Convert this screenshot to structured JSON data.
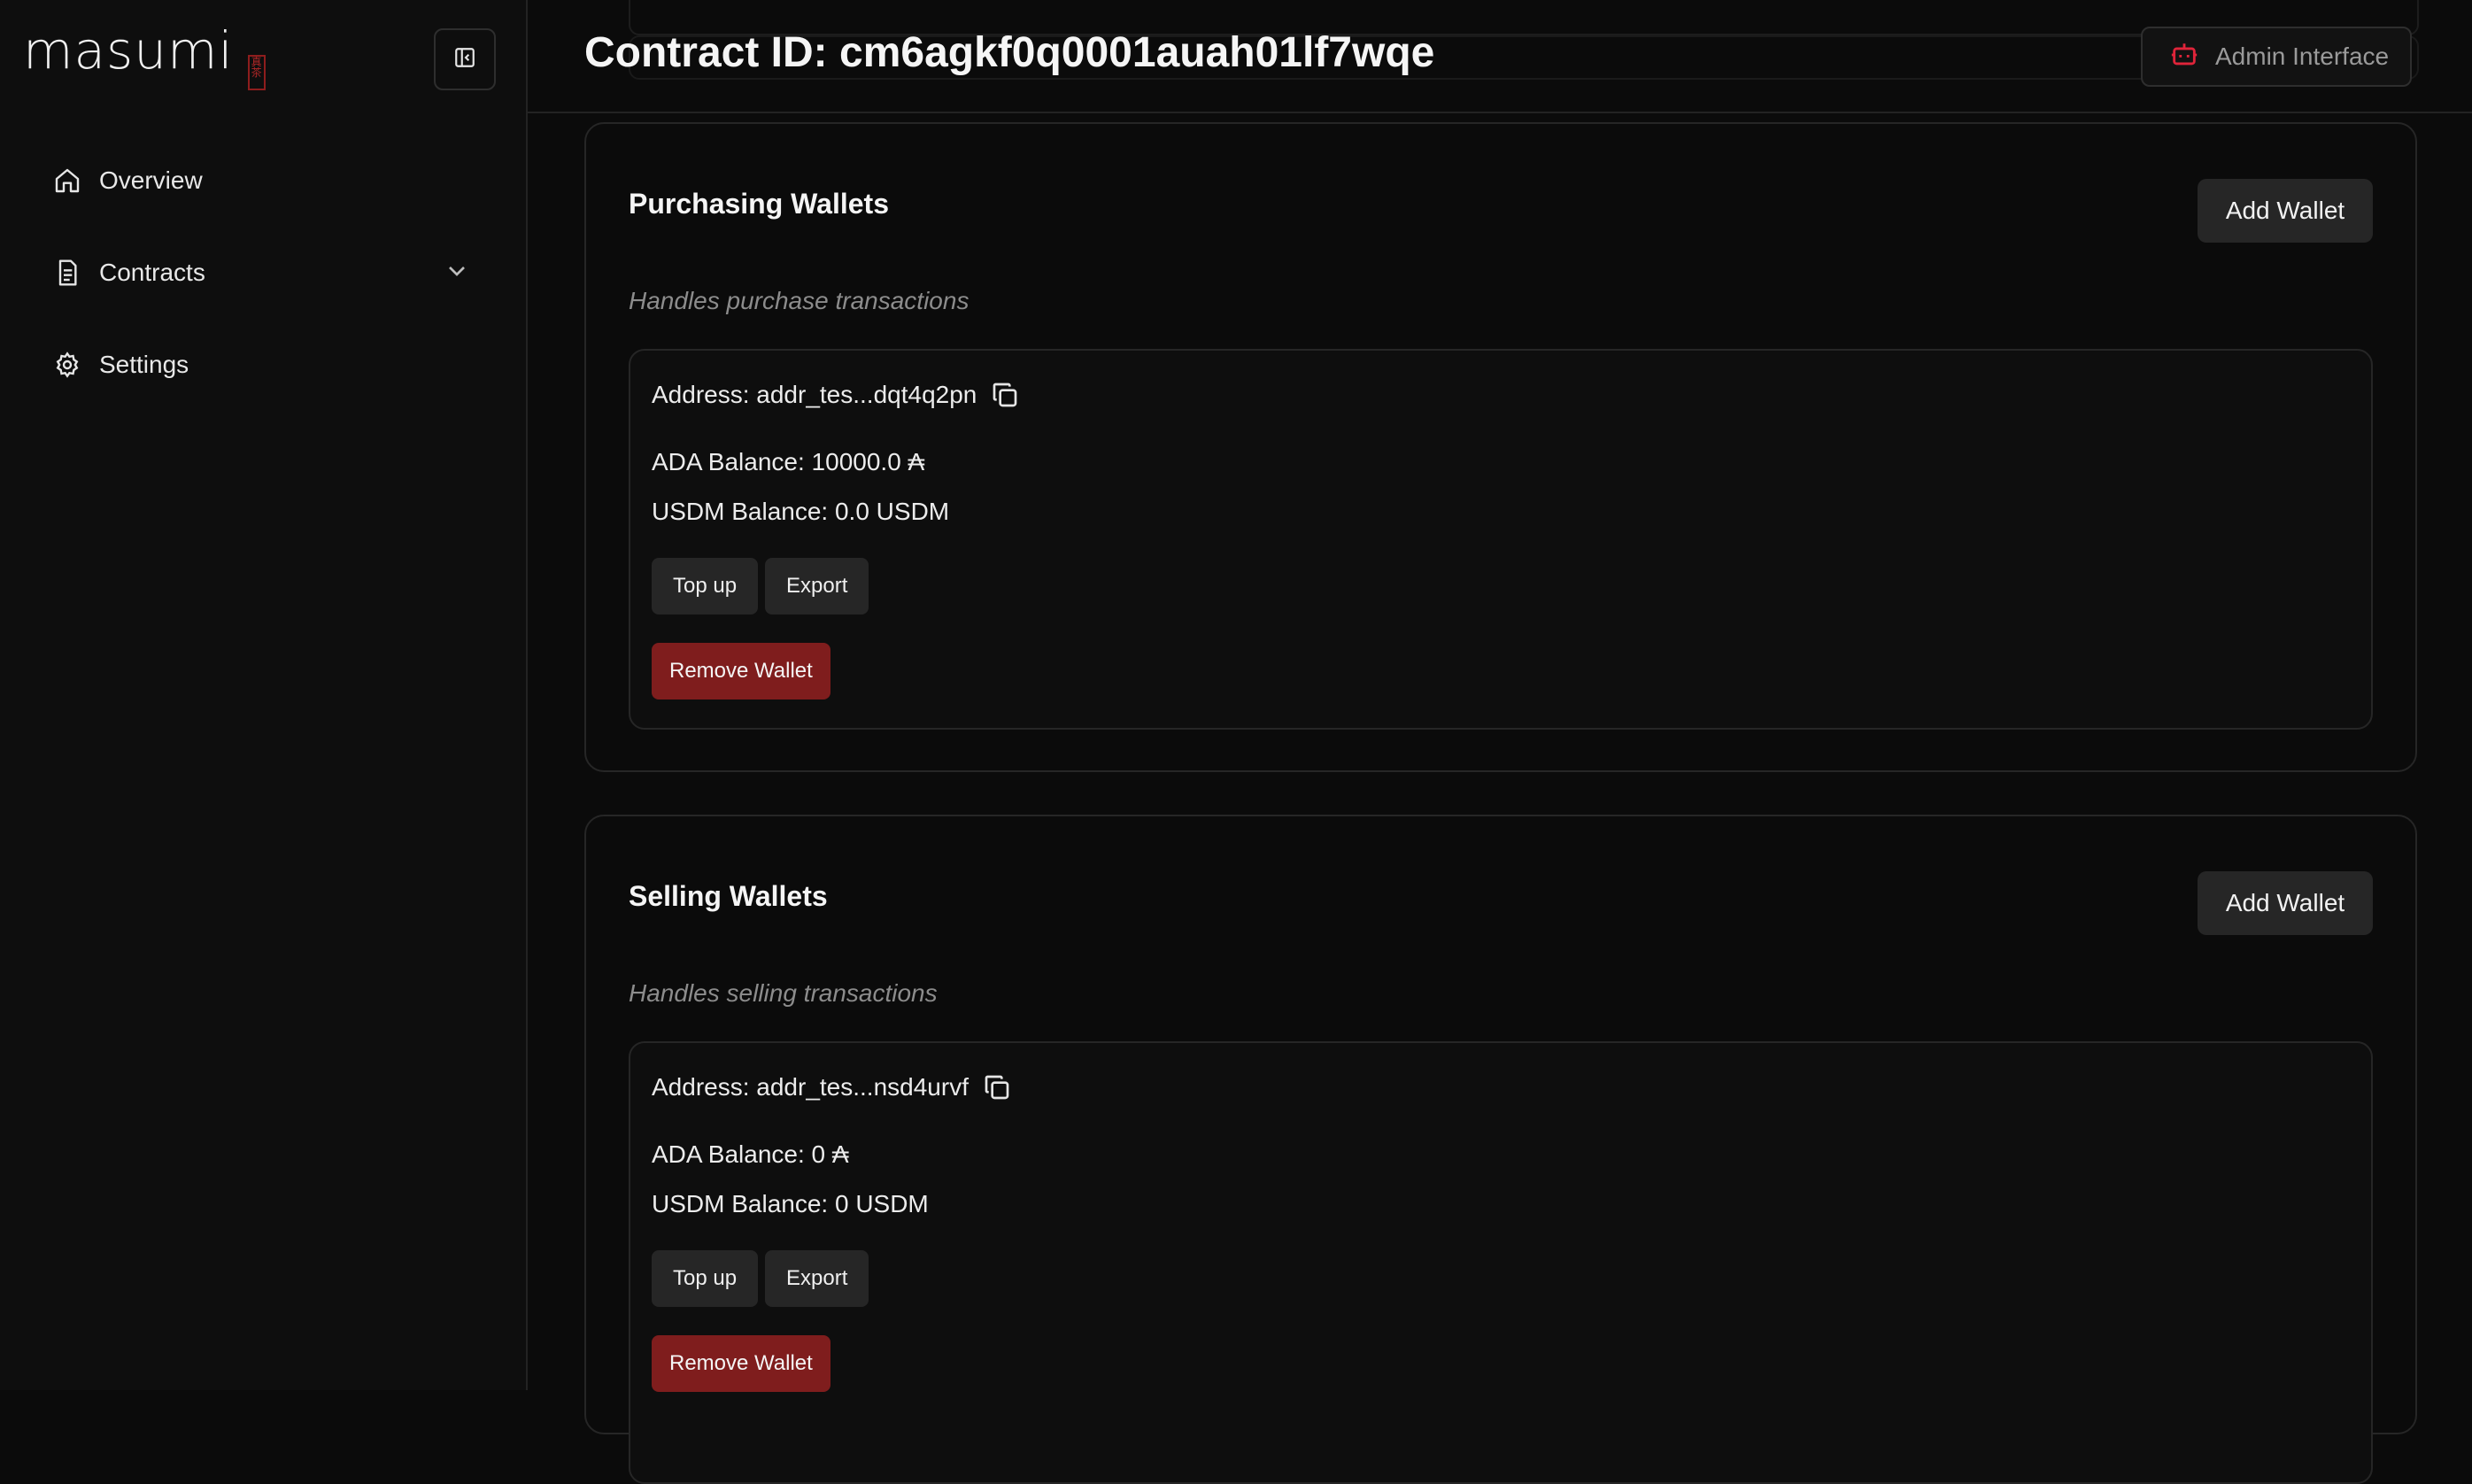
{
  "app": {
    "logo_text": "masumi",
    "logo_seal": "真茶"
  },
  "sidebar": {
    "items": [
      {
        "label": "Overview",
        "icon": "home-icon"
      },
      {
        "label": "Contracts",
        "icon": "document-icon",
        "expandable": true
      },
      {
        "label": "Settings",
        "icon": "gear-icon"
      }
    ]
  },
  "header": {
    "title": "Contract ID: cm6agkf0q0001auah01lf7wqe",
    "admin_label": "Admin Interface",
    "admin_icon": "bot-icon"
  },
  "colors": {
    "accent_red": "#e0243a",
    "remove_red": "#7f1d1d"
  },
  "sections": [
    {
      "title": "Purchasing Wallets",
      "add_label": "Add Wallet",
      "description": "Handles purchase transactions",
      "wallet": {
        "address": "Address: addr_tes...dqt4q2pn",
        "ada": "ADA Balance: 10000.0 ₳",
        "usdm": "USDM Balance: 0.0 USDM",
        "topup_label": "Top up",
        "export_label": "Export",
        "remove_label": "Remove Wallet"
      }
    },
    {
      "title": "Selling Wallets",
      "add_label": "Add Wallet",
      "description": "Handles selling transactions",
      "wallet": {
        "address": "Address: addr_tes...nsd4urvf",
        "ada": "ADA Balance: 0 ₳",
        "usdm": "USDM Balance: 0 USDM",
        "topup_label": "Top up",
        "export_label": "Export",
        "remove_label": "Remove Wallet"
      }
    }
  ]
}
